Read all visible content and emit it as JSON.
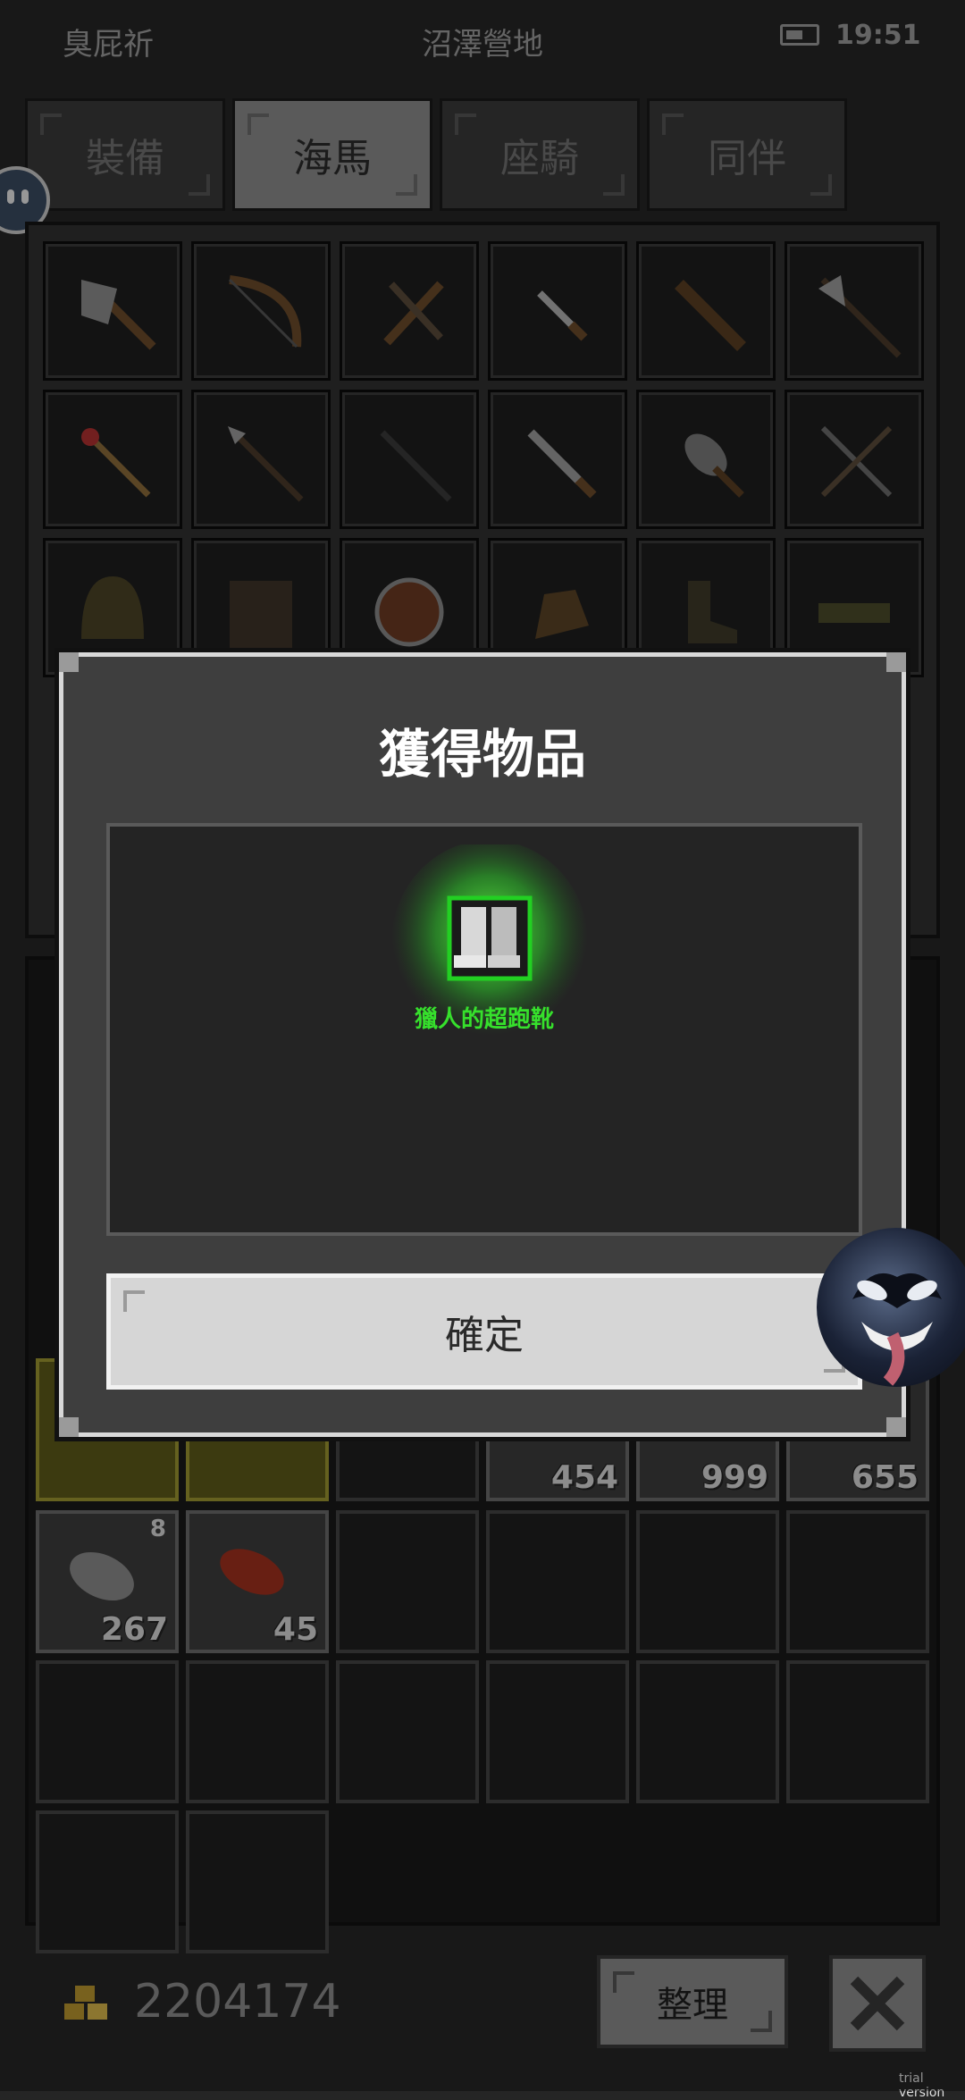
{
  "status_bar": {
    "player_name": "臭屁祈",
    "location": "沼澤營地",
    "time": "19:51",
    "battery_icon": "battery-icon"
  },
  "tabs": [
    {
      "label": "裝備",
      "active": false
    },
    {
      "label": "海馬",
      "active": true
    },
    {
      "label": "座騎",
      "active": false
    },
    {
      "label": "同伴",
      "active": false
    }
  ],
  "equipment_grid": {
    "rows": [
      [
        "axe-icon",
        "bow-icon",
        "crossbow-icon",
        "dagger-icon",
        "club-icon",
        "halberd-icon"
      ],
      [
        "staff-icon",
        "spear-icon",
        "long-spear-icon",
        "sword-icon",
        "mace-icon",
        "crossed-swords-icon"
      ],
      [
        "helmet-icon",
        "chest-armor-icon",
        "shield-icon",
        "gloves-icon",
        "boots-icon",
        "belt-icon"
      ]
    ]
  },
  "inventory": {
    "row_counts": [
      "454",
      "999",
      "655"
    ],
    "row2": [
      {
        "icon": "ore-icon",
        "count": "267",
        "corner": "8"
      },
      {
        "icon": "meat-icon",
        "count": "45",
        "corner": ""
      }
    ]
  },
  "footer": {
    "gold_amount": "2204174",
    "gold_icon": "gold-coins-icon",
    "sort_label": "整理",
    "close_icon": "close-icon"
  },
  "modal": {
    "title": "獲得物品",
    "item_name": "獵人的超跑靴",
    "item_icon": "boots-icon",
    "item_rarity_color": "#36e02c",
    "confirm_label": "確定"
  },
  "watermark": "trial version"
}
